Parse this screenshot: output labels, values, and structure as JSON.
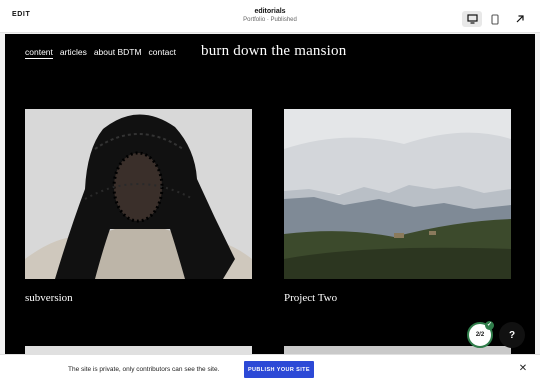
{
  "editor": {
    "edit_label": "EDIT",
    "page_title": "editorials",
    "page_status": "Portfolio · Published",
    "icons": [
      "desktop-icon",
      "mobile-icon",
      "open-external-icon"
    ]
  },
  "site": {
    "nav": [
      "content",
      "articles",
      "about BDTM",
      "contact"
    ],
    "title": "burn down the mansion",
    "cards": [
      {
        "label": "subversion"
      },
      {
        "label": "Project Two"
      }
    ]
  },
  "overlay": {
    "progress": "2/2",
    "help": "?"
  },
  "footer": {
    "message": "The site is private, only contributors can see the site.",
    "publish_label": "PUBLISH YOUR SITE",
    "close": "✕"
  },
  "colors": {
    "accent_blue": "#2c49d6",
    "badge_green": "#2f7d4a",
    "site_background": "#000000"
  }
}
